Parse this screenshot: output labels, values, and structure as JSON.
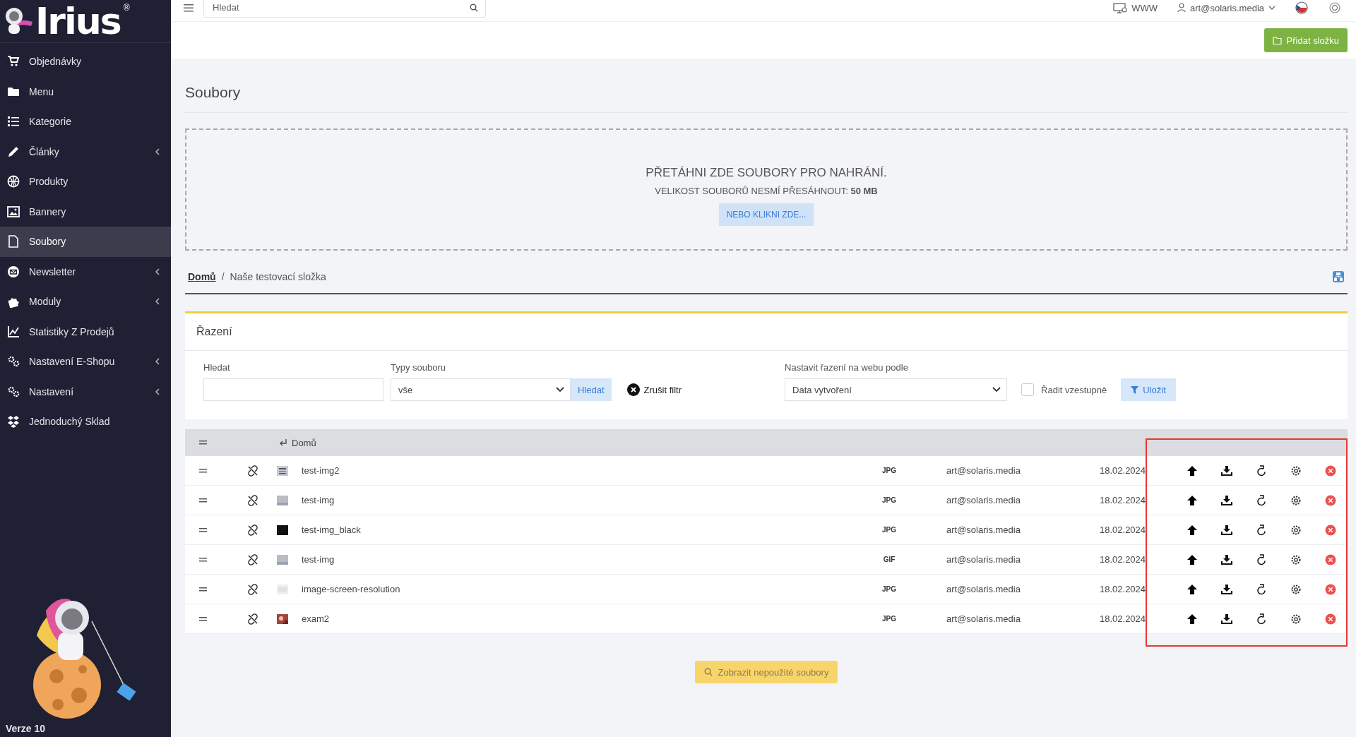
{
  "sidebar": {
    "logo": "Irius",
    "logo_mark": "®",
    "items": [
      {
        "label": "Objednávky",
        "selected": false,
        "expandable": false
      },
      {
        "label": "Menu",
        "selected": false,
        "expandable": false
      },
      {
        "label": "Kategorie",
        "selected": false,
        "expandable": false
      },
      {
        "label": "Články",
        "selected": false,
        "expandable": true
      },
      {
        "label": "Produkty",
        "selected": false,
        "expandable": false
      },
      {
        "label": "Bannery",
        "selected": false,
        "expandable": false
      },
      {
        "label": "Soubory",
        "selected": true,
        "expandable": false
      },
      {
        "label": "Newsletter",
        "selected": false,
        "expandable": true
      },
      {
        "label": "Moduly",
        "selected": false,
        "expandable": true
      },
      {
        "label": "Statistiky Z Prodejů",
        "selected": false,
        "expandable": false
      },
      {
        "label": "Nastavení E-Shopu",
        "selected": false,
        "expandable": true
      },
      {
        "label": "Nastavení",
        "selected": false,
        "expandable": true
      },
      {
        "label": "Jednoduchý Sklad",
        "selected": false,
        "expandable": false
      }
    ],
    "version": "Verze 10"
  },
  "topbar": {
    "search": {
      "placeholder": "Hledat"
    },
    "www": "WWW",
    "user": "art@solaris.media"
  },
  "toolbar": {
    "add_folder": "Přidat složku"
  },
  "page_title": "Soubory",
  "dropzone": {
    "title": "PŘETÁHNI ZDE SOUBORY PRO NAHRÁNÍ.",
    "limit": "VELIKOST SOUBORŮ NESMÍ PŘESÁHNOUT: **50 MB**",
    "button": "NEBO KLIKNI ZDE..."
  },
  "breadcrumb": [
    {
      "label": "Domů",
      "link": true
    },
    {
      "label": "Naše testovací složka",
      "link": false
    }
  ],
  "breadcrumb_separator": "/",
  "filter": {
    "title": "Řazení",
    "search_label": "Hledat",
    "types_label": "Typy souboru",
    "types_value": "vše",
    "search_button": "Hledat",
    "clear": "Zrušit filtr",
    "sort_label": "Nastavit řazení na webu podle",
    "sort_value": "Data vytvoření",
    "ascending": {
      "label": "Řadit vzestupně",
      "checked": false
    },
    "save": "Uložit"
  },
  "table": {
    "parent": "Domů",
    "rows": [
      {
        "name": "test-img2",
        "type": "JPG",
        "author": "art@solaris.media",
        "date": "18.02.2024"
      },
      {
        "name": "test-img",
        "type": "JPG",
        "author": "art@solaris.media",
        "date": "18.02.2024"
      },
      {
        "name": "test-img_black",
        "type": "JPG",
        "author": "art@solaris.media",
        "date": "18.02.2024"
      },
      {
        "name": "test-img",
        "type": "GIF",
        "author": "art@solaris.media",
        "date": "18.02.2024"
      },
      {
        "name": "image-screen-resolution",
        "type": "JPG",
        "author": "art@solaris.media",
        "date": "18.02.2024"
      },
      {
        "name": "exam2",
        "type": "JPG",
        "author": "art@solaris.media",
        "date": "18.02.2024"
      }
    ]
  },
  "unused_button": "Zobrazit nepoužité soubory"
}
